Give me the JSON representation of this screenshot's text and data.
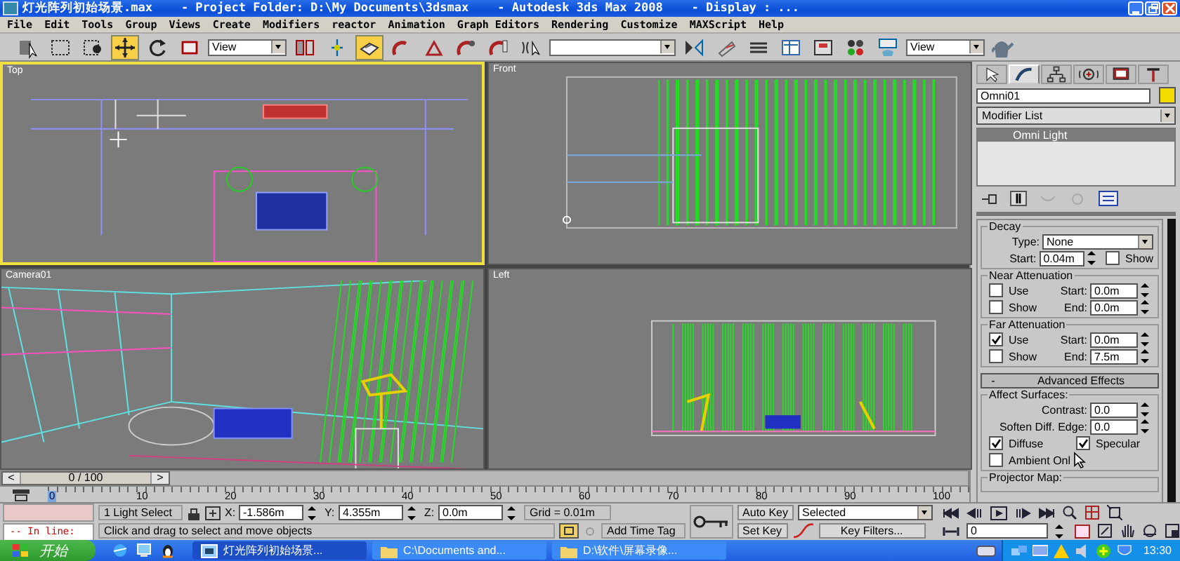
{
  "window": {
    "title": "灯光阵列初始场景.max    - Project Folder: D:\\My Documents\\3dsmax    - Autodesk 3ds Max 2008    - Display : ..."
  },
  "menu": [
    "File",
    "Edit",
    "Tools",
    "Group",
    "Views",
    "Create",
    "Modifiers",
    "reactor",
    "Animation",
    "Graph Editors",
    "Rendering",
    "Customize",
    "MAXScript",
    "Help"
  ],
  "toolbar": [
    {
      "kind": "button",
      "selected": false
    },
    {
      "kind": "button",
      "selected": false
    },
    {
      "kind": "button",
      "selected": false
    },
    {
      "kind": "button",
      "selected": true
    },
    {
      "kind": "button",
      "selected": false
    },
    {
      "kind": "button",
      "selected": false
    },
    {
      "kind": "dropdown",
      "value": "View"
    },
    {
      "kind": "button",
      "selected": false
    },
    {
      "kind": "button",
      "selected": false
    },
    {
      "kind": "button",
      "selected": true
    },
    {
      "kind": "button",
      "selected": false
    },
    {
      "kind": "button",
      "selected": false
    },
    {
      "kind": "button",
      "selected": false
    },
    {
      "kind": "button",
      "selected": false
    },
    {
      "kind": "button",
      "selected": false
    },
    {
      "kind": "dropdown"
    },
    {
      "kind": "button",
      "selected": false
    },
    {
      "kind": "button",
      "selected": false
    },
    {
      "kind": "button",
      "selected": false
    },
    {
      "kind": "button",
      "selected": false
    },
    {
      "kind": "button",
      "selected": false
    },
    {
      "kind": "button",
      "selected": false
    },
    {
      "kind": "button",
      "selected": false
    },
    {
      "kind": "dropdown",
      "value": "View"
    },
    {
      "kind": "button",
      "selected": false
    }
  ],
  "viewports": [
    {
      "label": "Top",
      "selected": true
    },
    {
      "label": "Front",
      "selected": false
    },
    {
      "label": "Camera01",
      "selected": false
    },
    {
      "label": "Left",
      "selected": false
    }
  ],
  "time_slider": {
    "prev": "<",
    "label": "0 / 100",
    "next": ">",
    "level": 0
  },
  "ruler": [
    "0",
    "10",
    "20",
    "30",
    "40",
    "50",
    "60",
    "70",
    "80",
    "90",
    "100"
  ],
  "command_panel": {
    "tabs": [
      {
        "selected": false
      },
      {
        "selected": true
      },
      {
        "selected": false
      },
      {
        "selected": false
      },
      {
        "selected": false
      },
      {
        "selected": false
      }
    ],
    "object_name": "Omni01",
    "modifier_list": "Modifier List",
    "stack": [
      {
        "label": "Omni Light",
        "selected": true
      }
    ],
    "decay": {
      "title": "Decay",
      "type_label": "Type:",
      "type": "None",
      "start_label": "Start:",
      "start": "0.04m",
      "show_label": "Show",
      "show": false
    },
    "near_attenuation": {
      "title": "Near Attenuation",
      "use_label": "Use",
      "use": false,
      "show_label": "Show",
      "show": false,
      "start_label": "Start:",
      "start": "0.0m",
      "end_label": "End:",
      "end": "0.0m"
    },
    "far_attenuation": {
      "title": "Far Attenuation",
      "use_label": "Use",
      "use": true,
      "show_label": "Show",
      "show": false,
      "start_label": "Start:",
      "start": "0.0m",
      "end_label": "End:",
      "end": "7.5m"
    },
    "advanced_effects": {
      "toggle": "-",
      "title": "Advanced Effects",
      "group": "Affect Surfaces:",
      "contrast_label": "Contrast:",
      "contrast": "0.0",
      "soften_label": "Soften Diff. Edge:",
      "soften": "0.0",
      "diffuse_label": "Diffuse",
      "diffuse": true,
      "specular_label": "Specular",
      "specular": true,
      "ambient_label": "Ambient Onl",
      "ambient": false,
      "projector_map": "Projector Map:"
    }
  },
  "status": {
    "listener": "-- In line:",
    "selection": "1 Light Select",
    "x_label": "X:",
    "x": "-1.586m",
    "y_label": "Y:",
    "y": "4.355m",
    "z_label": "Z:",
    "z": "0.0m",
    "grid": "Grid = 0.01m",
    "prompt": "Click and drag to select and move objects",
    "time_tag": "Add Time Tag",
    "auto_key": "Auto Key",
    "key_mode": "Selected",
    "set_key": "Set Key",
    "key_filters": "Key Filters...",
    "frame": "0"
  },
  "taskbar": {
    "start": "开始",
    "tasks": [
      {
        "label": "灯光阵列初始场景...",
        "selected": true
      },
      {
        "label": "C:\\Documents and...",
        "selected": false
      },
      {
        "label": "D:\\软件\\屏幕录像...",
        "selected": false
      }
    ],
    "clock": "13:30"
  }
}
